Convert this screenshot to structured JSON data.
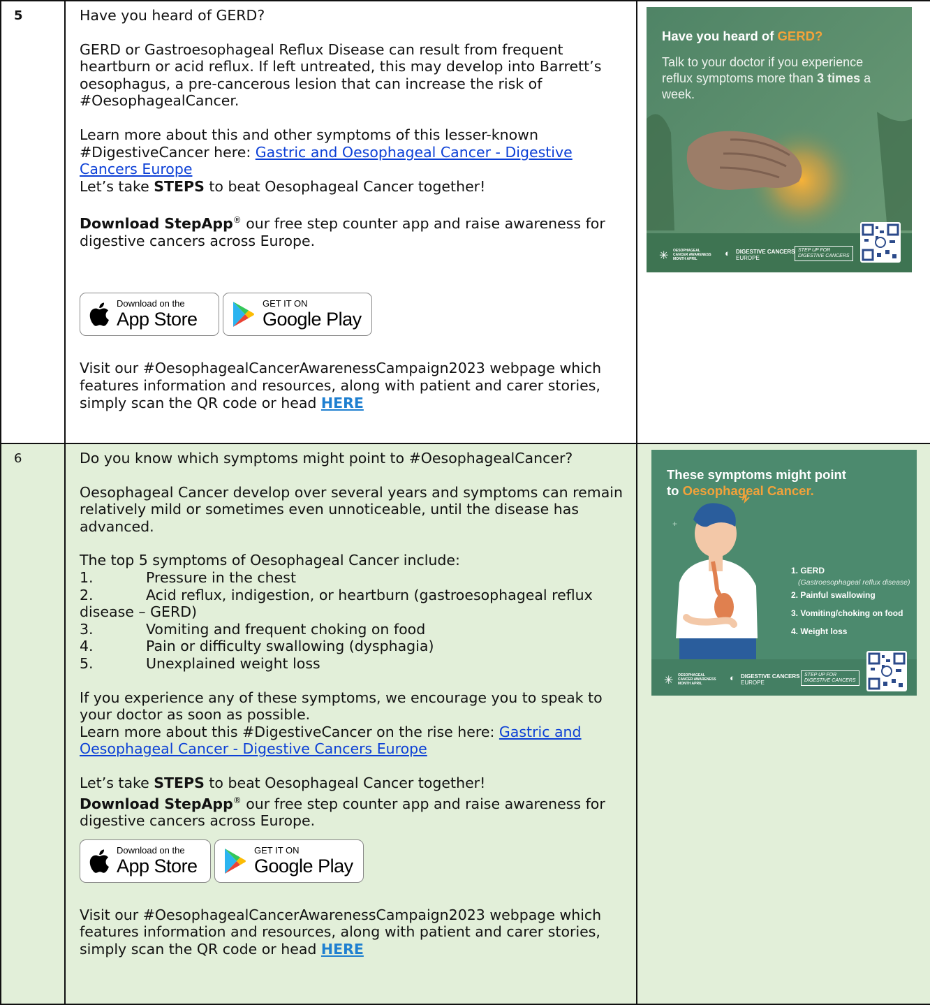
{
  "rows": [
    {
      "number": "5",
      "heading": "Have you heard of GERD?",
      "para1": "GERD or Gastroesophageal Reflux Disease can result from frequent heartburn or acid reflux. If left untreated, this may develop into Barrett’s oesophagus, a pre-cancerous lesion that can increase the risk of #OesophagealCancer.",
      "learn_prefix": "Learn more about this and other symptoms of this lesser-known #DigestiveCancer here: ",
      "link_text": "Gastric and Oesophageal Cancer - Digestive Cancers Europe",
      "steps_pre": "Let’s take ",
      "steps_bold": "STEPS",
      "steps_post": " to beat Oesophageal Cancer together!",
      "download_bold": "Download StepApp",
      "reg": "®",
      "download_rest": " our free step counter app and raise awareness for digestive cancers across Europe.",
      "visit": "Visit our #OesophagealCancerAwarenessCampaign2023 webpage which features information and resources, along with patient and carer stories, simply scan the QR code or head ",
      "here": "HERE",
      "poster": {
        "title_pre": "Have you heard of ",
        "title_accent": "GERD?",
        "sub_pre": "Talk to your doctor if you experience reflux symptoms more than ",
        "sub_bold": "3 times",
        "sub_post": " a week."
      }
    },
    {
      "number": "6",
      "heading": "Do you know which symptoms might point to #OesophagealCancer?",
      "para1": "Oesophageal Cancer develop over several years and symptoms can remain relatively mild or sometimes even unnoticeable, until the disease has advanced.",
      "list_intro": "The top 5 symptoms of Oesophageal Cancer include:",
      "list": [
        {
          "n": "1.",
          "t": "Pressure in the chest"
        },
        {
          "n": "2.",
          "t": "Acid reflux, indigestion, or heartburn (gastroesophageal reflux"
        },
        {
          "n": "3.",
          "t": "Vomiting and frequent choking on food"
        },
        {
          "n": "4.",
          "t": "Pain or difficulty swallowing (dysphagia)"
        },
        {
          "n": "5.",
          "t": "Unexplained weight loss"
        }
      ],
      "list_cont": "disease – GERD)",
      "encourage": "If you experience any of these symptoms, we encourage you to speak to your doctor as soon as possible.",
      "learn_prefix": "Learn more about this #DigestiveCancer on the rise here: ",
      "link_text": "Gastric and Oesophageal Cancer - Digestive Cancers Europe",
      "steps_pre": "Let’s take ",
      "steps_bold": "STEPS",
      "steps_post": " to beat Oesophageal Cancer together!",
      "download_bold": "Download StepApp",
      "reg": "®",
      "download_rest": " our free step counter app and raise awareness for digestive cancers across Europe.",
      "visit": "Visit our #OesophagealCancerAwarenessCampaign2023 webpage which features information and resources, along with patient and carer stories, simply scan the QR code or head ",
      "here": "HERE",
      "poster": {
        "title1": "These symptoms might point",
        "title2_pre": "to ",
        "title2_accent": "Oesophageal Cancer.",
        "items": [
          "1. GERD",
          "(Gastroesophageal reflux disease)",
          "2. Painful swallowing",
          "3. Vomiting/choking on food",
          "4. Weight loss"
        ]
      }
    }
  ],
  "badges": {
    "apple_small": "Download on the",
    "apple_big": "App Store",
    "google_small": "GET IT ON",
    "google_big": "Google Play"
  },
  "poster_footer": {
    "month_logo": "OESOPHAGEAL CANCER AWARENESS MONTH APRIL",
    "dce_logo": "DIGESTIVE CANCERS",
    "dce_sub": "EUROPE",
    "step_up": "STEP UP FOR",
    "step_up2": "DIGESTIVE CANCERS"
  },
  "colors": {
    "row6_bg": "#e2efd9",
    "link": "#0b3fd6",
    "here": "#1e7fd0",
    "poster_green": "#4c8a6e",
    "accent_orange": "#f3a23a"
  }
}
